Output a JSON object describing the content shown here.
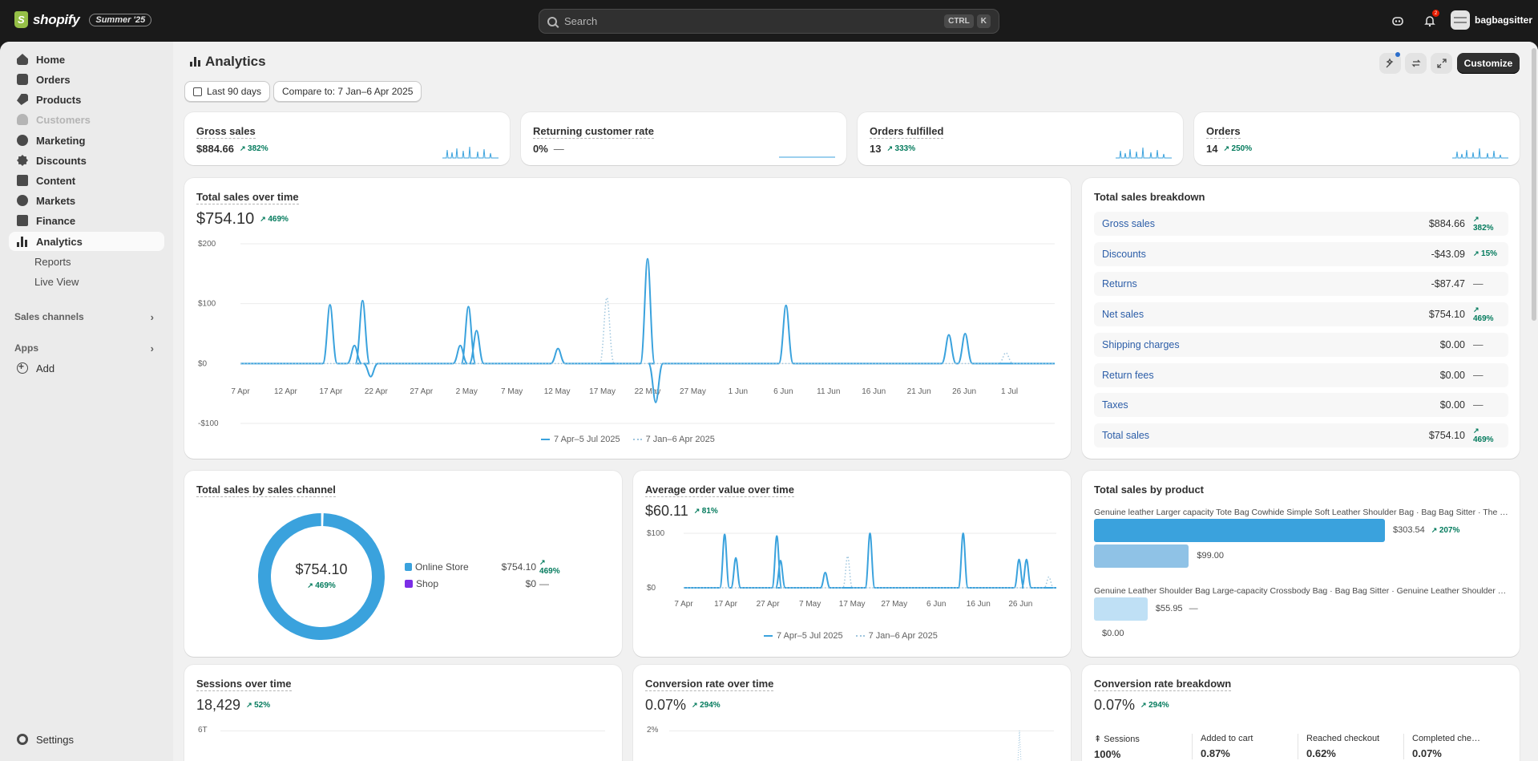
{
  "topbar": {
    "brand": "shopify",
    "edition": "Summer '25",
    "search_placeholder": "Search",
    "shortcut_1": "CTRL",
    "shortcut_2": "K",
    "notification_count": "2",
    "store_name": "bagbagsitter"
  },
  "sidebar": {
    "items": [
      {
        "label": "Home",
        "icon": "home-icon"
      },
      {
        "label": "Orders",
        "icon": "orders-icon"
      },
      {
        "label": "Products",
        "icon": "products-icon"
      },
      {
        "label": "Customers",
        "icon": "customers-icon"
      },
      {
        "label": "Marketing",
        "icon": "marketing-icon"
      },
      {
        "label": "Discounts",
        "icon": "discounts-icon"
      },
      {
        "label": "Content",
        "icon": "content-icon"
      },
      {
        "label": "Markets",
        "icon": "markets-icon"
      },
      {
        "label": "Finance",
        "icon": "finance-icon"
      },
      {
        "label": "Analytics",
        "icon": "analytics-icon"
      }
    ],
    "sub_items": [
      "Reports",
      "Live View"
    ],
    "sales_channels": "Sales channels",
    "apps": "Apps",
    "add": "Add",
    "settings": "Settings"
  },
  "header": {
    "title": "Analytics",
    "date_range": "Last 90 days",
    "compare": "Compare to: 7 Jan–6 Apr 2025",
    "customize": "Customize"
  },
  "kpis": [
    {
      "title": "Gross sales",
      "value": "$884.66",
      "delta": "382%"
    },
    {
      "title": "Returning customer rate",
      "value": "0%",
      "delta": "—"
    },
    {
      "title": "Orders fulfilled",
      "value": "13",
      "delta": "333%"
    },
    {
      "title": "Orders",
      "value": "14",
      "delta": "250%"
    }
  ],
  "total_sales": {
    "title": "Total sales over time",
    "value": "$754.10",
    "delta": "469%",
    "legend_current": "7 Apr–5 Jul 2025",
    "legend_previous": "7 Jan–6 Apr 2025"
  },
  "breakdown": {
    "title": "Total sales breakdown",
    "rows": [
      {
        "name": "Gross sales",
        "value": "$884.66",
        "delta": "382%"
      },
      {
        "name": "Discounts",
        "value": "-$43.09",
        "delta": "15%"
      },
      {
        "name": "Returns",
        "value": "-$87.47",
        "delta": "—"
      },
      {
        "name": "Net sales",
        "value": "$754.10",
        "delta": "469%"
      },
      {
        "name": "Shipping charges",
        "value": "$0.00",
        "delta": "—"
      },
      {
        "name": "Return fees",
        "value": "$0.00",
        "delta": "—"
      },
      {
        "name": "Taxes",
        "value": "$0.00",
        "delta": "—"
      },
      {
        "name": "Total sales",
        "value": "$754.10",
        "delta": "469%"
      }
    ]
  },
  "channel": {
    "title": "Total sales by sales channel",
    "center_value": "$754.10",
    "center_delta": "469%",
    "rows": [
      {
        "name": "Online Store",
        "value": "$754.10",
        "delta": "469%",
        "color": "#3aa2dd"
      },
      {
        "name": "Shop",
        "value": "$0",
        "delta": "—",
        "color": "#7b2ee6"
      }
    ]
  },
  "aov": {
    "title": "Average order value over time",
    "value": "$60.11",
    "delta": "81%",
    "legend_current": "7 Apr–5 Jul 2025",
    "legend_previous": "7 Jan–6 Apr 2025"
  },
  "by_product": {
    "title": "Total sales by product",
    "products": [
      {
        "name": "Genuine leather Larger capacity Tote Bag Cowhide Simple Soft Leather Shoulder Bag · Bag Bag Sitter · The …",
        "current": "$303.54",
        "delta": "207%",
        "previous": "$99.00"
      },
      {
        "name": "Genuine Leather Shoulder Bag Large-capacity Crossbody Bag · Bag Bag Sitter · Genuine Leather Shoulder B…",
        "current": "$55.95",
        "delta": "—",
        "previous": "$0.00"
      }
    ]
  },
  "sessions": {
    "title": "Sessions over time",
    "value": "18,429",
    "delta": "52%",
    "axis_top": "6T"
  },
  "conversion": {
    "title": "Conversion rate over time",
    "value": "0.07%",
    "delta": "294%",
    "axis_top": "2%"
  },
  "conv_breakdown": {
    "title": "Conversion rate breakdown",
    "value": "0.07%",
    "delta": "294%",
    "steps": [
      {
        "label": "Sessions",
        "value": "100%"
      },
      {
        "label": "Added to cart",
        "value": "0.87%"
      },
      {
        "label": "Reached checkout",
        "value": "0.62%"
      },
      {
        "label": "Completed che…",
        "value": "0.07%"
      }
    ]
  },
  "chart_data": [
    {
      "type": "line",
      "title": "Total sales over time",
      "x": [
        "7 Apr",
        "12 Apr",
        "17 Apr",
        "22 Apr",
        "27 Apr",
        "2 May",
        "7 May",
        "12 May",
        "17 May",
        "22 May",
        "27 May",
        "1 Jun",
        "6 Jun",
        "11 Jun",
        "16 Jun",
        "21 Jun",
        "26 Jun",
        "1 Jul"
      ],
      "y_ticks": [
        "$200",
        "$100",
        "$0",
        "-$100"
      ],
      "ylim": [
        -100,
        200
      ],
      "series": [
        {
          "name": "7 Apr–5 Jul 2025",
          "points": [
            [
              11,
              98
            ],
            [
              14,
              30
            ],
            [
              15,
              105
            ],
            [
              16,
              -22
            ],
            [
              27,
              30
            ],
            [
              28,
              95
            ],
            [
              29,
              55
            ],
            [
              39,
              25
            ],
            [
              50,
              175
            ],
            [
              51,
              -65
            ],
            [
              67,
              97
            ],
            [
              87,
              48
            ],
            [
              89,
              50
            ]
          ]
        },
        {
          "name": "7 Jan–6 Apr 2025",
          "points": [
            [
              45,
              110
            ],
            [
              94,
              18
            ]
          ]
        }
      ]
    },
    {
      "type": "line",
      "title": "Average order value over time",
      "x": [
        "7 Apr",
        "17 Apr",
        "27 Apr",
        "7 May",
        "17 May",
        "27 May",
        "6 Jun",
        "16 Jun",
        "26 Jun"
      ],
      "y_ticks": [
        "$100",
        "$0"
      ],
      "ylim": [
        0,
        100
      ],
      "series": [
        {
          "name": "7 Apr–5 Jul 2025",
          "points": [
            [
              11,
              98
            ],
            [
              14,
              55
            ],
            [
              25,
              95
            ],
            [
              26,
              50
            ],
            [
              38,
              28
            ],
            [
              50,
              100
            ],
            [
              75,
              100
            ],
            [
              90,
              52
            ],
            [
              92,
              52
            ]
          ]
        },
        {
          "name": "7 Jan–6 Apr 2025",
          "points": [
            [
              44,
              58
            ],
            [
              98,
              20
            ]
          ]
        }
      ]
    },
    {
      "type": "pie",
      "title": "Total sales by sales channel",
      "categories": [
        "Online Store",
        "Shop"
      ],
      "values": [
        754.1,
        0
      ]
    },
    {
      "type": "bar",
      "title": "Total sales by product",
      "categories": [
        "Genuine leather Larger capacity Tote Bag",
        "Genuine Leather Shoulder Bag Large-capacity Crossbody Bag"
      ],
      "series": [
        {
          "name": "7 Apr–5 Jul 2025",
          "values": [
            303.54,
            55.95
          ]
        },
        {
          "name": "7 Jan–6 Apr 2025",
          "values": [
            99.0,
            0.0
          ]
        }
      ]
    }
  ]
}
